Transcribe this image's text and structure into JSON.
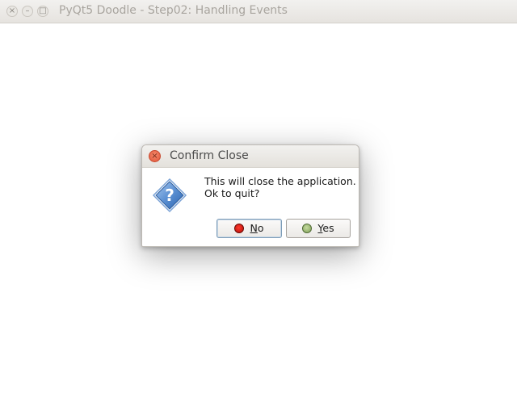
{
  "window": {
    "title": "PyQt5 Doodle - Step02: Handling Events",
    "controls": {
      "close_glyph": "×",
      "minimize_glyph": "–",
      "maximize_glyph": "□"
    }
  },
  "dialog": {
    "title": "Confirm Close",
    "close_glyph": "×",
    "icon": "question-icon",
    "message_line1": "This will close the application.",
    "message_line2": "Ok to quit?",
    "buttons": {
      "no": {
        "mnemonic": "N",
        "rest": "o",
        "icon": "red-circle-icon"
      },
      "yes": {
        "mnemonic": "Y",
        "rest": "es",
        "icon": "green-circle-icon"
      }
    }
  },
  "colors": {
    "titlebar": "#e8e6e3",
    "close_button": "#e95c3f",
    "icon_blue": "#3f78c4"
  }
}
